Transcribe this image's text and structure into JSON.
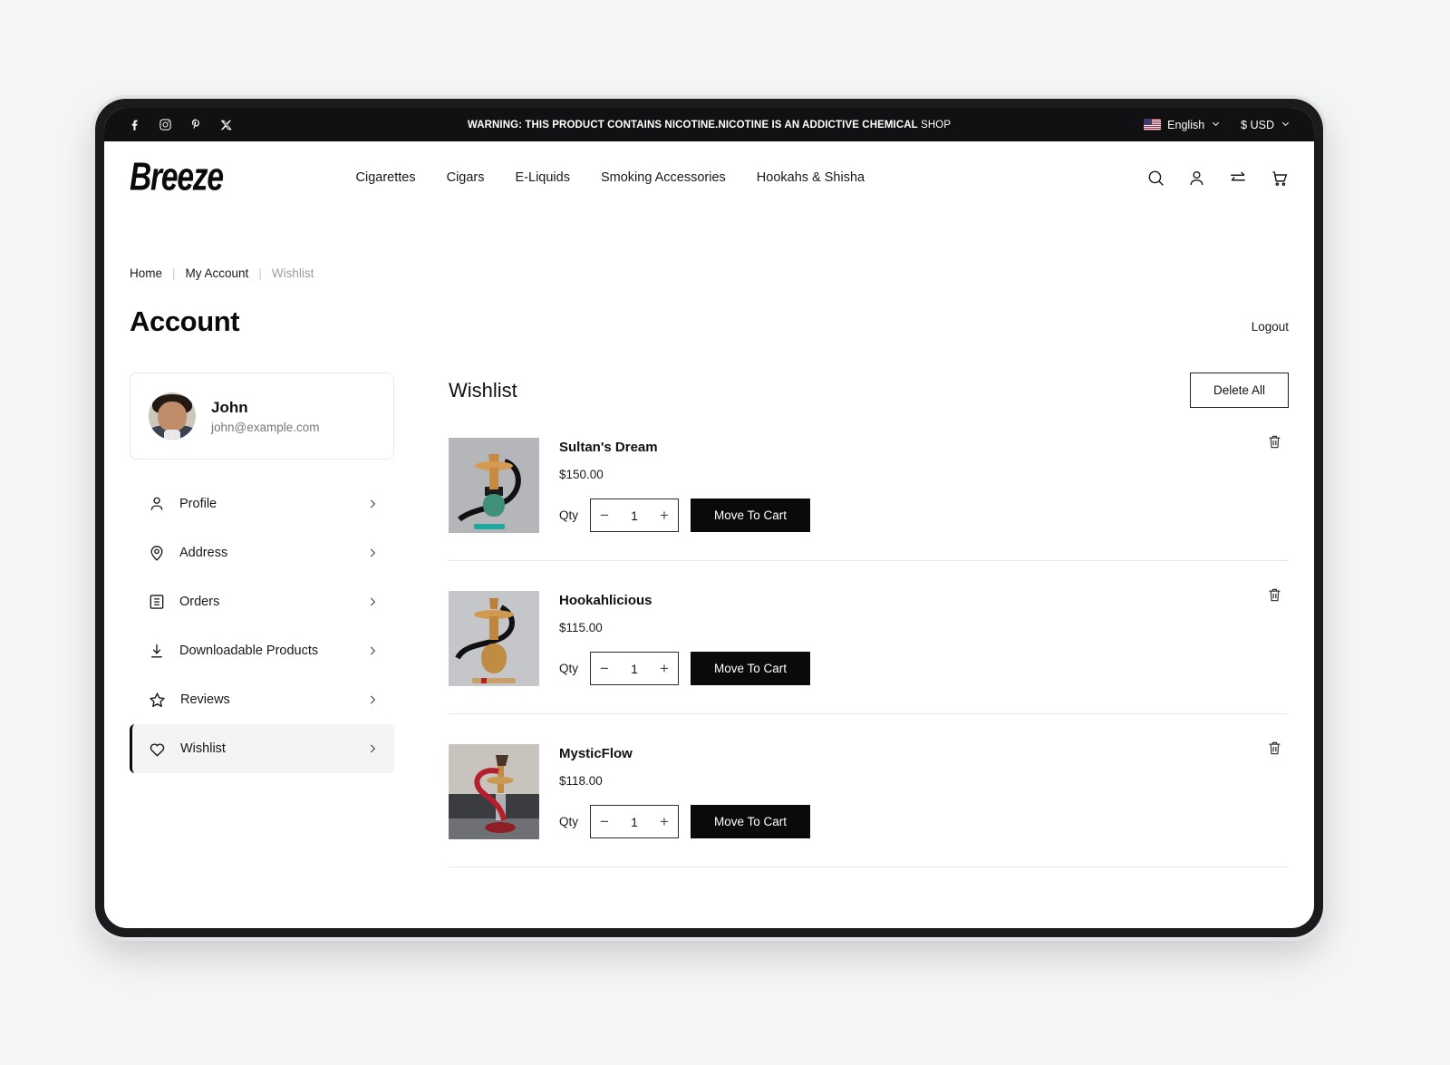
{
  "announcement": {
    "warning_bold": "WARNING: THIS PRODUCT CONTAINS NICOTINE.NICOTINE IS AN ADDICTIVE CHEMICAL",
    "shop_label": "SHOP",
    "social": [
      {
        "name": "facebook-icon"
      },
      {
        "name": "instagram-icon"
      },
      {
        "name": "pinterest-icon"
      },
      {
        "name": "x-twitter-icon"
      }
    ],
    "language": "English",
    "currency": "$ USD"
  },
  "header": {
    "logo": "Breeze",
    "nav": [
      {
        "label": "Cigarettes"
      },
      {
        "label": "Cigars"
      },
      {
        "label": "E-Liquids"
      },
      {
        "label": "Smoking Accessories"
      },
      {
        "label": "Hookahs & Shisha"
      }
    ],
    "icons": [
      "search-icon",
      "account-icon",
      "compare-icon",
      "cart-icon"
    ]
  },
  "breadcrumb": {
    "home": "Home",
    "separator": "|",
    "my_account": "My Account",
    "current": "Wishlist"
  },
  "account": {
    "title": "Account",
    "logout": "Logout"
  },
  "sidebar": {
    "user": {
      "name": "John",
      "email": "john@example.com"
    },
    "items": [
      {
        "label": "Profile",
        "icon": "person-icon",
        "active": false
      },
      {
        "label": "Address",
        "icon": "map-pin-icon",
        "active": false
      },
      {
        "label": "Orders",
        "icon": "list-icon",
        "active": false
      },
      {
        "label": "Downloadable Products",
        "icon": "download-icon",
        "active": false
      },
      {
        "label": "Reviews",
        "icon": "star-icon",
        "active": false
      },
      {
        "label": "Wishlist",
        "icon": "heart-icon",
        "active": true
      }
    ]
  },
  "wishlist": {
    "title": "Wishlist",
    "delete_all_label": "Delete All",
    "qty_label": "Qty",
    "move_label": "Move To Cart",
    "items": [
      {
        "name": "Sultan's Dream",
        "price": "$150.00",
        "qty": "1"
      },
      {
        "name": "Hookahlicious",
        "price": "$115.00",
        "qty": "1"
      },
      {
        "name": "MysticFlow",
        "price": "$118.00",
        "qty": "1"
      }
    ]
  },
  "colors": {
    "accent": "#0a0a0a",
    "page_bg": "#f4f5f7",
    "muted": "#9b9c9f",
    "border": "#e6e7e9"
  }
}
